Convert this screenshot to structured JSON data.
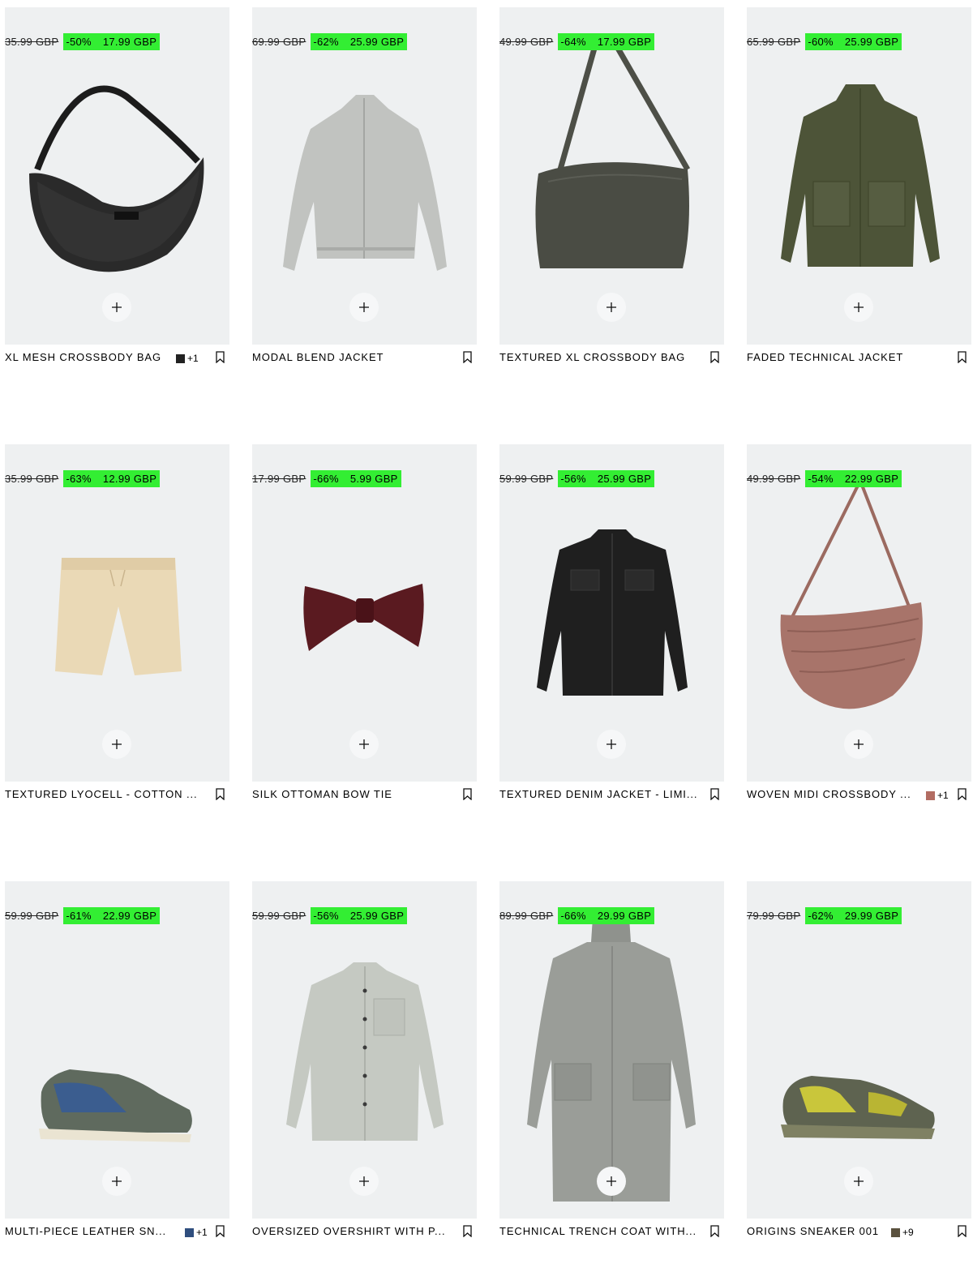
{
  "products": [
    {
      "name": "XL MESH CROSSBODY BAG",
      "swatch_color": "#222222",
      "swatch_more": "+1",
      "old_price": "35.99 GBP",
      "discount": "-50%",
      "price": "17.99 GBP",
      "icon": "mesh-bag-image"
    },
    {
      "name": "MODAL BLEND JACKET",
      "old_price": "69.99 GBP",
      "discount": "-62%",
      "price": "25.99 GBP",
      "icon": "jacket-image"
    },
    {
      "name": "TEXTURED XL CROSSBODY BAG",
      "old_price": "49.99 GBP",
      "discount": "-64%",
      "price": "17.99 GBP",
      "icon": "hobo-bag-image"
    },
    {
      "name": "FADED TECHNICAL JACKET",
      "old_price": "65.99 GBP",
      "discount": "-60%",
      "price": "25.99 GBP",
      "icon": "field-jacket-image"
    },
    {
      "name": "TEXTURED LYOCELL - COTTON ...",
      "old_price": "35.99 GBP",
      "discount": "-63%",
      "price": "12.99 GBP",
      "icon": "shorts-image"
    },
    {
      "name": "SILK OTTOMAN BOW TIE",
      "old_price": "17.99 GBP",
      "discount": "-66%",
      "price": "5.99 GBP",
      "icon": "bow-tie-image"
    },
    {
      "name": "TEXTURED DENIM JACKET - LIMI...",
      "old_price": "59.99 GBP",
      "discount": "-56%",
      "price": "25.99 GBP",
      "icon": "denim-jacket-image"
    },
    {
      "name": "WOVEN MIDI CROSSBODY ...",
      "swatch_color": "#b26c62",
      "swatch_more": "+1",
      "old_price": "49.99 GBP",
      "discount": "-54%",
      "price": "22.99 GBP",
      "icon": "woven-bag-image"
    },
    {
      "name": "MULTI-PIECE LEATHER SN...",
      "swatch_color": "#2f4e7e",
      "swatch_more": "+1",
      "old_price": "59.99 GBP",
      "discount": "-61%",
      "price": "22.99 GBP",
      "icon": "sneaker-image"
    },
    {
      "name": "OVERSIZED OVERSHIRT WITH P...",
      "old_price": "59.99 GBP",
      "discount": "-56%",
      "price": "25.99 GBP",
      "icon": "overshirt-image"
    },
    {
      "name": "TECHNICAL TRENCH COAT WITH...",
      "old_price": "89.99 GBP",
      "discount": "-66%",
      "price": "29.99 GBP",
      "icon": "trench-coat-image"
    },
    {
      "name": "ORIGINS SNEAKER 001",
      "swatch_color": "#5a513e",
      "swatch_more": "+9",
      "old_price": "79.99 GBP",
      "discount": "-62%",
      "price": "29.99 GBP",
      "icon": "trail-sneaker-image"
    }
  ],
  "colors": {
    "sale_highlight": "#33ee33",
    "image_bg": "#eef0f1"
  }
}
